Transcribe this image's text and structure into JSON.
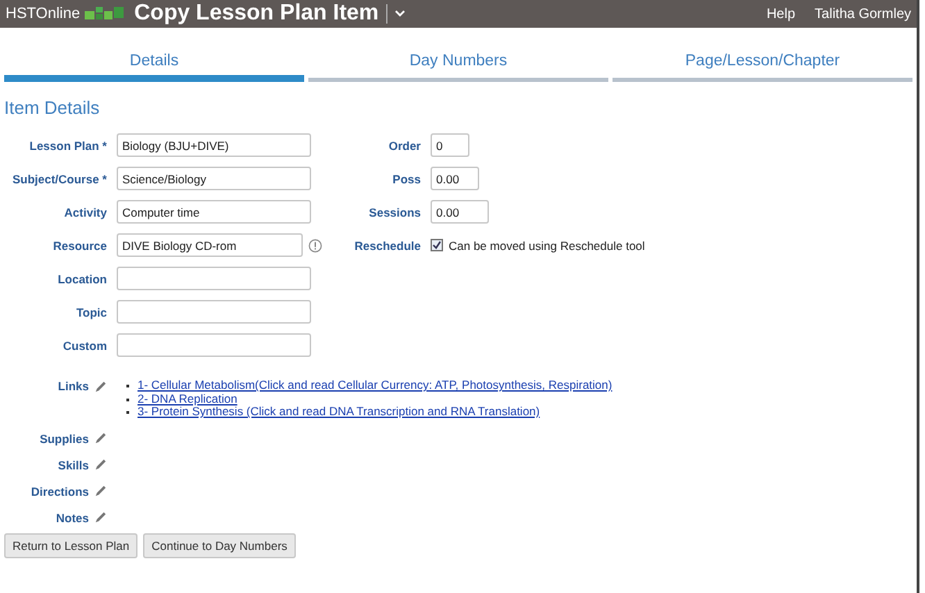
{
  "header": {
    "brand": "HSTOnline",
    "title": "Copy Lesson Plan Item",
    "links": [
      "Help",
      "Talitha Gormley"
    ]
  },
  "tabs": [
    {
      "label": "Details",
      "selected": true
    },
    {
      "label": "Day Numbers",
      "selected": false
    },
    {
      "label": "Page/Lesson/Chapter",
      "selected": false
    }
  ],
  "section_title": "Item Details",
  "fields": [
    {
      "label": "Lesson Plan *",
      "value": "Biology (BJU+DIVE)"
    },
    {
      "label": "Subject/Course *",
      "value": "Science/Biology"
    },
    {
      "label": "Activity",
      "value": "Computer time"
    },
    {
      "label": "Resource",
      "value": "DIVE Biology CD-rom",
      "info": true
    },
    {
      "label": "Location"
    },
    {
      "label": "Topic"
    },
    {
      "label": "Custom"
    }
  ],
  "side_fields": [
    {
      "kind": "number",
      "label": "Order",
      "value": "0"
    },
    {
      "kind": "number",
      "label": "Poss",
      "value": "0.00"
    },
    {
      "kind": "number",
      "label": "Sessions",
      "value": "0.00"
    },
    {
      "kind": "checkbox",
      "label": "Reschedule",
      "checked": true,
      "text": "Can be moved using Reschedule tool"
    }
  ],
  "links_label": "Links",
  "links": [
    "1- Cellular Metabolism(Click and read Cellular Currency: ATP, Photosynthesis, Respiration)",
    "2- DNA Replication",
    "3- Protein Synthesis (Click and read DNA Transcription and RNA Translation)"
  ],
  "edit_rows": [
    "Supplies",
    "Skills",
    "Directions",
    "Notes"
  ],
  "buttons": [
    "Return to Lesson Plan",
    "Continue to Day Numbers"
  ]
}
